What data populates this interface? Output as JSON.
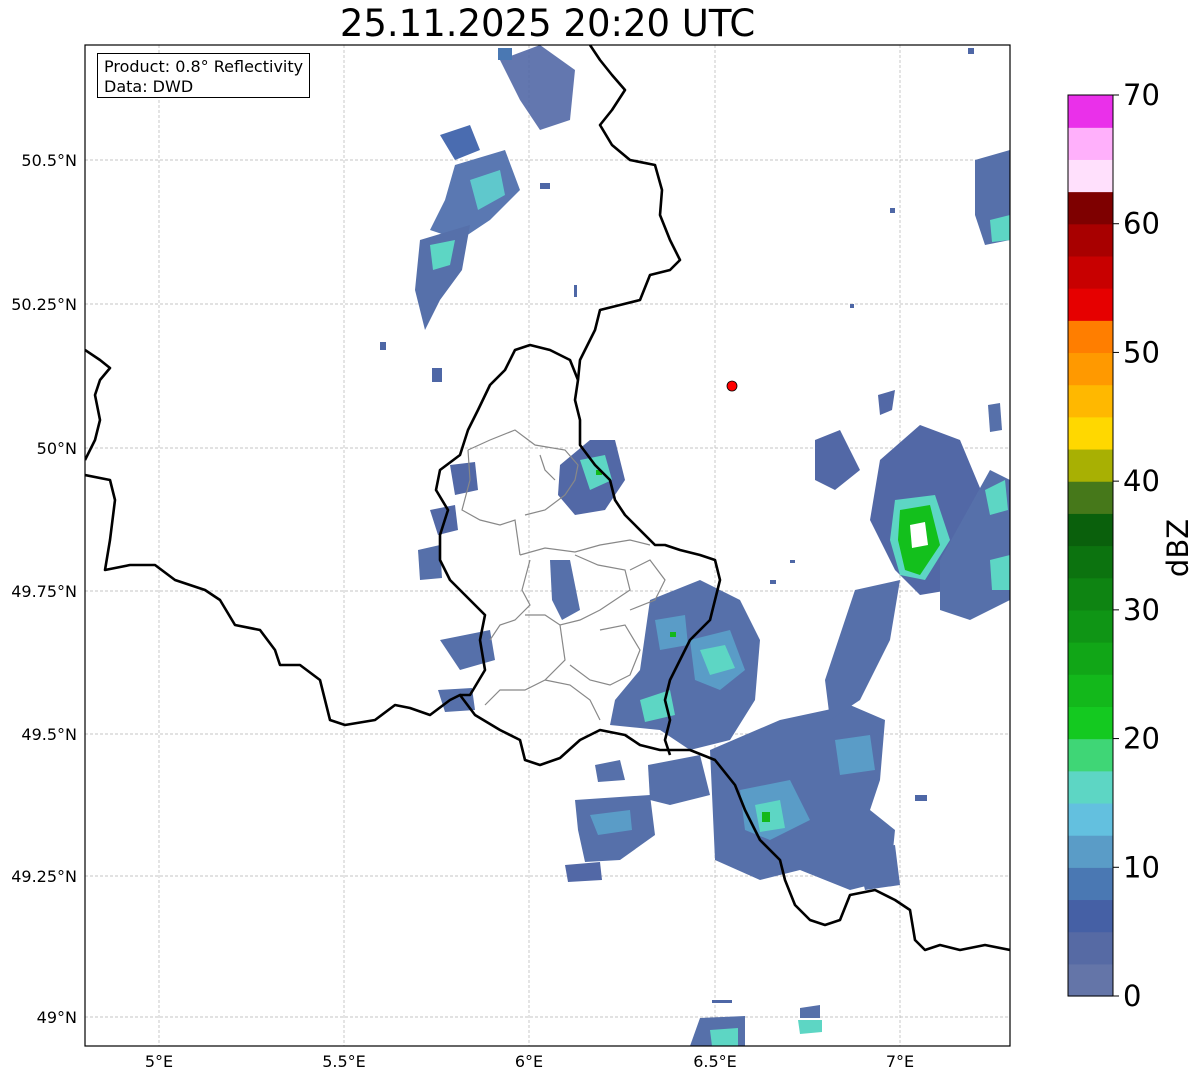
{
  "title": "25.11.2025 20:20 UTC",
  "info": {
    "product": "Product: 0.8° Reflectivity",
    "source": "Data: DWD"
  },
  "axes": {
    "lon_ticks": [
      "5°E",
      "5.5°E",
      "6°E",
      "6.5°E",
      "7°E"
    ],
    "lat_ticks": [
      "50.5°N",
      "50.25°N",
      "50°N",
      "49.75°N",
      "49.5°N",
      "49.25°N",
      "49°N"
    ]
  },
  "colorbar": {
    "label": "dBZ",
    "tick_labels": [
      "0",
      "10",
      "20",
      "30",
      "40",
      "50",
      "60",
      "70"
    ],
    "colors": [
      "#6475a8",
      "#566aa4",
      "#4560a5",
      "#4a78b3",
      "#5a9cc7",
      "#63c0df",
      "#5dd6c4",
      "#3fd676",
      "#14c920",
      "#13b81b",
      "#11a617",
      "#0f9515",
      "#0e8412",
      "#0c730f",
      "#0a600c",
      "#46781a",
      "#a8b003",
      "#ffd800",
      "#ffb800",
      "#ff9900",
      "#ff7e00",
      "#e60000",
      "#c80000",
      "#a80000",
      "#7e0000",
      "#ffe0fc",
      "#ffb0fb",
      "#ff70f8",
      "#ea30ea"
    ]
  },
  "marker": {
    "name": "radar-site-marker",
    "color": "#ff0000"
  },
  "colors": {
    "border": "#000000",
    "district": "#888888",
    "grid": "#b4b4b4"
  },
  "chart_data": {
    "type": "heatmap",
    "title": "25.11.2025 20:20 UTC",
    "xlabel": "",
    "ylabel": "",
    "xlim": [
      4.8,
      7.3
    ],
    "ylim": [
      48.95,
      50.7
    ],
    "colorbar": {
      "label": "dBZ",
      "range": [
        0,
        70
      ]
    },
    "marker": {
      "lon": 6.55,
      "lat": 50.11
    },
    "echo_cells": [
      {
        "lon": 6.15,
        "lat": 49.95,
        "dbz": 18
      },
      {
        "lon": 6.38,
        "lat": 49.62,
        "dbz": 15
      },
      {
        "lon": 6.65,
        "lat": 49.35,
        "dbz": 20
      },
      {
        "lon": 7.05,
        "lat": 49.85,
        "dbz": 25
      },
      {
        "lon": 5.85,
        "lat": 50.4,
        "dbz": 15
      },
      {
        "lon": 7.25,
        "lat": 50.35,
        "dbz": 12
      },
      {
        "lon": 6.53,
        "lat": 48.98,
        "dbz": 15
      }
    ]
  }
}
